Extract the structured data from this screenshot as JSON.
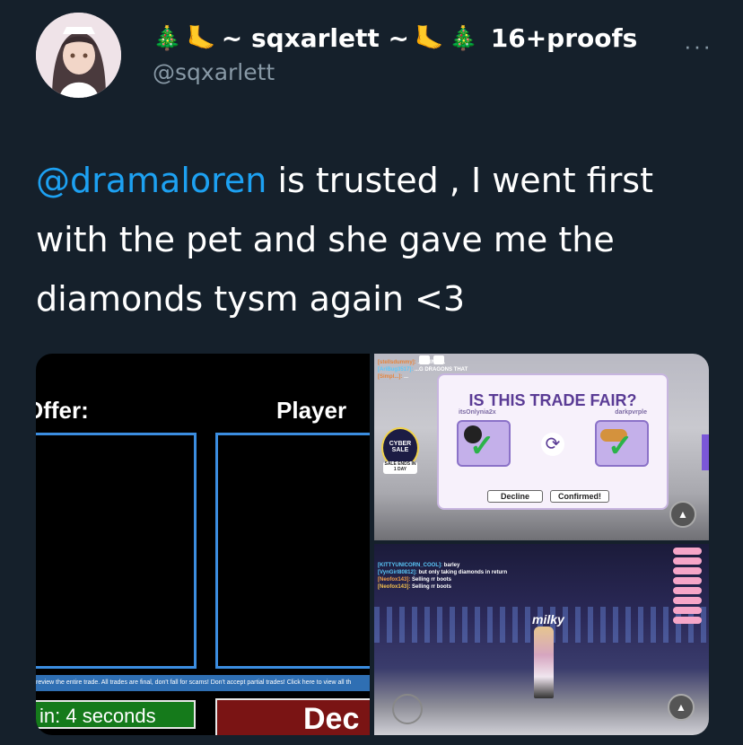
{
  "tweet": {
    "display_name": "~ sqxarlett ~",
    "name_suffix": "16+proofs",
    "handle": "@sqxarlett",
    "more_icon": "more-dots-icon",
    "mention": "@dramaloren",
    "text_rest": " is trusted , I went first with the pet and she gave me the diamonds tysm again <3"
  },
  "media": {
    "left": {
      "offer_label": "Offer:",
      "player_label": "Player",
      "warning": "review the entire trade. All trades are final, don't fall for scams! Don't accept partial trades! Click here to view all th",
      "timer": "in: 4 seconds",
      "decline": "Dec"
    },
    "right_top": {
      "chat_lines": [
        {
          "name": "[stellsdummy]:",
          "msg": " ...AKING ..."
        },
        {
          "name": "[AriBug3517]:",
          "msg": " ...G DRAGONS THAT"
        },
        {
          "name": "[Simpl...]:",
          "msg": " ..."
        }
      ],
      "cyber_sale": "CYBER SALE",
      "sale_ends": "SALE ENDS IN 1 DAY",
      "trade_title": "IS THIS TRADE FAIR?",
      "player_left": "itsOnlynia2x",
      "player_right": "darkpvrple",
      "decline_button": "Decline",
      "confirmed_button": "Confirmed!"
    },
    "right_bottom": {
      "chat_lines": [
        {
          "name": "[KITTYUNICORN_COOL]:",
          "msg": " barley"
        },
        {
          "name": "[VynGirl80812]:",
          "msg": " but only taking diamonds in return"
        },
        {
          "name": "[Neofox143]:",
          "msg": " Selling rr boots"
        },
        {
          "name": "[Neofox143]:",
          "msg": " Selling rr boots"
        }
      ],
      "player_tag": "milky"
    }
  }
}
